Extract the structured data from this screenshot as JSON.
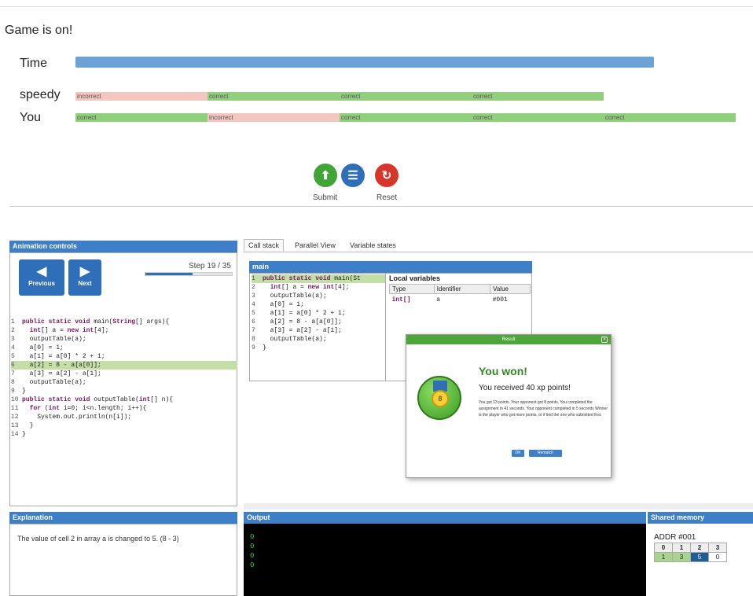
{
  "game": {
    "status": "Game is on!",
    "time_label": "Time",
    "opponent_label": "speedy",
    "you_label": "You",
    "time_fraction": 0.8,
    "opponent_results": [
      "incorrect",
      "correct",
      "correct",
      "correct"
    ],
    "you_results": [
      "correct",
      "incorrect",
      "correct",
      "correct",
      "correct"
    ]
  },
  "actions": {
    "submit_label": "Submit",
    "reset_label": "Reset"
  },
  "animation": {
    "title": "Animation controls",
    "previous_label": "Previous",
    "next_label": "Next",
    "step_text": "Step 19 / 35",
    "step_current": 19,
    "step_total": 35
  },
  "source_code": [
    {
      "n": "1",
      "text": "public static void main(String[] args){"
    },
    {
      "n": "2",
      "text": "  int[] a = new int[4];"
    },
    {
      "n": "3",
      "text": "  outputTable(a);"
    },
    {
      "n": "4",
      "text": "  a[0] = 1;"
    },
    {
      "n": "5",
      "text": "  a[1] = a[0] * 2 + 1;"
    },
    {
      "n": "6",
      "text": "  a[2] = 8 - a[a[0]];",
      "highlight": true
    },
    {
      "n": "7",
      "text": "  a[3] = a[2] - a[1];"
    },
    {
      "n": "8",
      "text": "  outputTable(a);"
    },
    {
      "n": "9",
      "text": "}"
    },
    {
      "n": "10",
      "text": "public static void outputTable(int[] n){"
    },
    {
      "n": "11",
      "text": "  for (int i=0; i<n.length; i++){"
    },
    {
      "n": "12",
      "text": "    System.out.println(n[i]);"
    },
    {
      "n": "13",
      "text": "  }"
    },
    {
      "n": "14",
      "text": "}"
    }
  ],
  "tabs": [
    "Call stack",
    "Parallel View",
    "Variable states"
  ],
  "frame": {
    "title": "main",
    "code": [
      {
        "n": "1",
        "text": "public static void main(St",
        "highlight": true
      },
      {
        "n": "2",
        "text": "  int[] a = new int[4];"
      },
      {
        "n": "3",
        "text": "  outputTable(a);"
      },
      {
        "n": "4",
        "text": "  a[0] = 1;"
      },
      {
        "n": "5",
        "text": "  a[1] = a[0] * 2 + 1;"
      },
      {
        "n": "6",
        "text": "  a[2] = 8 - a[a[0]];"
      },
      {
        "n": "7",
        "text": "  a[3] = a[2] - a[1];"
      },
      {
        "n": "8",
        "text": "  outputTable(a);"
      },
      {
        "n": "9",
        "text": "}"
      }
    ],
    "locals_title": "Local variables",
    "locals_headers": [
      "Type",
      "Identifier",
      "Value"
    ],
    "locals": [
      {
        "type": "int[]",
        "identifier": "a",
        "value": "#001"
      }
    ]
  },
  "dialog": {
    "title": "Result",
    "heading": "You won!",
    "subheading": "You received 40 xp points!",
    "body": "You got 13 points. Your opponent got 8 points. You completed the assignment in 41 seconds. Your opponent completed in 5 seconds Winner is the player who got more points, or if tied the one who submitted first.",
    "ok_label": "OK",
    "rematch_label": "Rematch"
  },
  "explanation": {
    "title": "Explanation",
    "text": "The value of cell 2 in array a is changed to 5. (8 - 3)"
  },
  "output": {
    "title": "Output",
    "lines": [
      "0",
      "0",
      "0",
      "0"
    ]
  },
  "memory": {
    "title": "Shared memory",
    "addr": "ADDR #001",
    "indices": [
      "0",
      "1",
      "2",
      "3"
    ],
    "values": [
      "1",
      "3",
      "5",
      "0"
    ],
    "highlight_index": 2
  },
  "colors": {
    "accent": "#3d7fc8",
    "correct": "#8fd07a",
    "incorrect": "#f5c6c0",
    "submit": "#3fa535",
    "list": "#2f6fb9",
    "reset": "#d9362b"
  }
}
